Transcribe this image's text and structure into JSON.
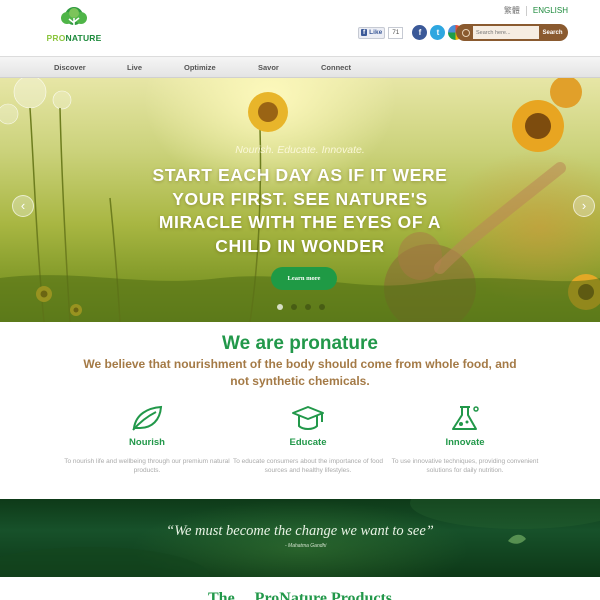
{
  "brand": {
    "name_part1": "PRO",
    "name_part2": "NATURE"
  },
  "lang": {
    "chinese": "繁體",
    "english": "ENGLISH"
  },
  "social": {
    "like_label": "Like",
    "like_count": "71"
  },
  "search": {
    "placeholder": "Search here...",
    "button_label": "Search"
  },
  "nav": {
    "items": [
      "Discover",
      "Live",
      "Optimize",
      "Savor",
      "Connect"
    ]
  },
  "hero": {
    "tagline": "Nourish. Educate. Innovate.",
    "headline": "Start each day as if it were your first. See nature's miracle with the eyes of a child in wonder",
    "cta_label": "Learn more",
    "slide_count": 4,
    "active_slide": 1
  },
  "about": {
    "title": "We are pronature",
    "subtitle": "We believe that nourishment of the body should come from whole food, and not synthetic chemicals.",
    "pillars": [
      {
        "icon": "leaf-icon",
        "title": "Nourish",
        "text": "To nourish life and wellbeing through our premium natural products."
      },
      {
        "icon": "graduation-cap-icon",
        "title": "Educate",
        "text": "To educate consumers about the importance of food sources and healthy lifestyles."
      },
      {
        "icon": "flask-icon",
        "title": "Innovate",
        "text": "To use innovative techniques, providing convenient solutions for daily nutrition."
      }
    ]
  },
  "quote": {
    "text": "“We must become the change we want to see”",
    "author": "- Mahatma Gandhi"
  },
  "bottom": {
    "title": "The ... ProNature Products"
  },
  "colors": {
    "brand_green": "#22984a",
    "accent_brown": "#a47a46",
    "search_brown": "#8a5a2f"
  }
}
